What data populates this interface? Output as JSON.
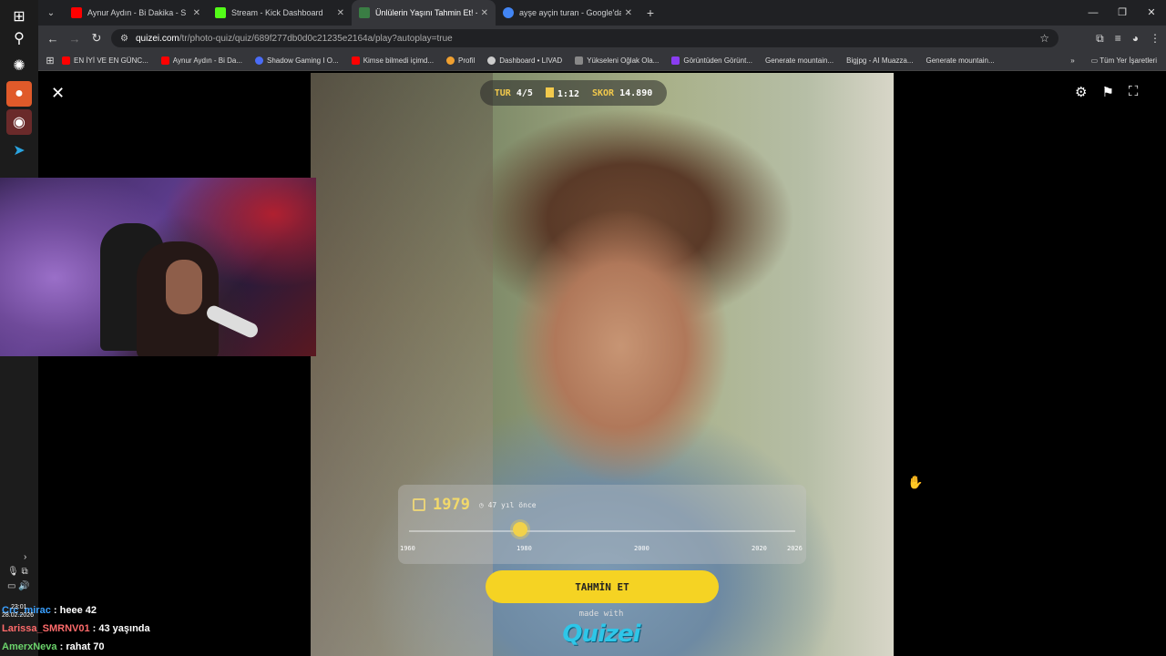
{
  "browser": {
    "tabs": [
      {
        "title": "Aynur Aydın - Bi Dakika - S",
        "color": "#ff0000",
        "active": false
      },
      {
        "title": "Stream - Kick Dashboard",
        "color": "#53fc18",
        "active": false
      },
      {
        "title": "Ünlülerin Yaşını Tahmin Et! - Q",
        "color": "#3a7d44",
        "active": true
      },
      {
        "title": "ayşe ayçin turan - Google'da A",
        "color": "#4285f4",
        "active": false
      }
    ],
    "url_host": "quizei.com",
    "url_path": "/tr/photo-quiz/quiz/689f277db0d0c21235e2164a/play?autoplay=true",
    "bookmarks": [
      {
        "label": "EN İYİ VE EN GÜNC...",
        "color": "#ff0000"
      },
      {
        "label": "Aynur Aydın - Bi Da...",
        "color": "#ff0000"
      },
      {
        "label": "Shadow Gaming I O...",
        "color": "#4a6cf7"
      },
      {
        "label": "Kimse bilmedi içimd...",
        "color": "#ff0000"
      },
      {
        "label": "Profil",
        "color": "#f0a030"
      },
      {
        "label": "Dashboard • LIVAD",
        "color": "#cccccc"
      },
      {
        "label": "Yükseleni Oğlak Ola...",
        "color": "#888888"
      },
      {
        "label": "Görüntüden Görünt...",
        "color": "#8a3df0"
      },
      {
        "label": "Generate mountain...",
        "color": "#333333"
      },
      {
        "label": "Bigjpg - AI Muazza...",
        "color": "#333333"
      },
      {
        "label": "Generate mountain...",
        "color": "#333333"
      }
    ],
    "bookmarks_all": "Tüm Yer İşaretleri"
  },
  "quiz": {
    "round_label": "TUR",
    "round_value": "4/5",
    "timer": "1:12",
    "score_label": "SKOR",
    "score_value": "14.890",
    "year": "1979",
    "years_ago": "47 yıl önce",
    "ticks": [
      "1960",
      "1980",
      "2000",
      "2020",
      "2026"
    ],
    "guess_button": "TAHMİN ET",
    "made_with": "made with",
    "logo": "Quizei"
  },
  "chat": {
    "clock_time": "23:01",
    "clock_date": "28.02.2026",
    "messages": [
      {
        "user": "Crc_mirac",
        "text": ": heee 42"
      },
      {
        "user": "Larissa_SMRNV01",
        "text": ": 43 yaşında"
      },
      {
        "user": "AmerxNeva",
        "text": ": rahat 70"
      }
    ]
  }
}
